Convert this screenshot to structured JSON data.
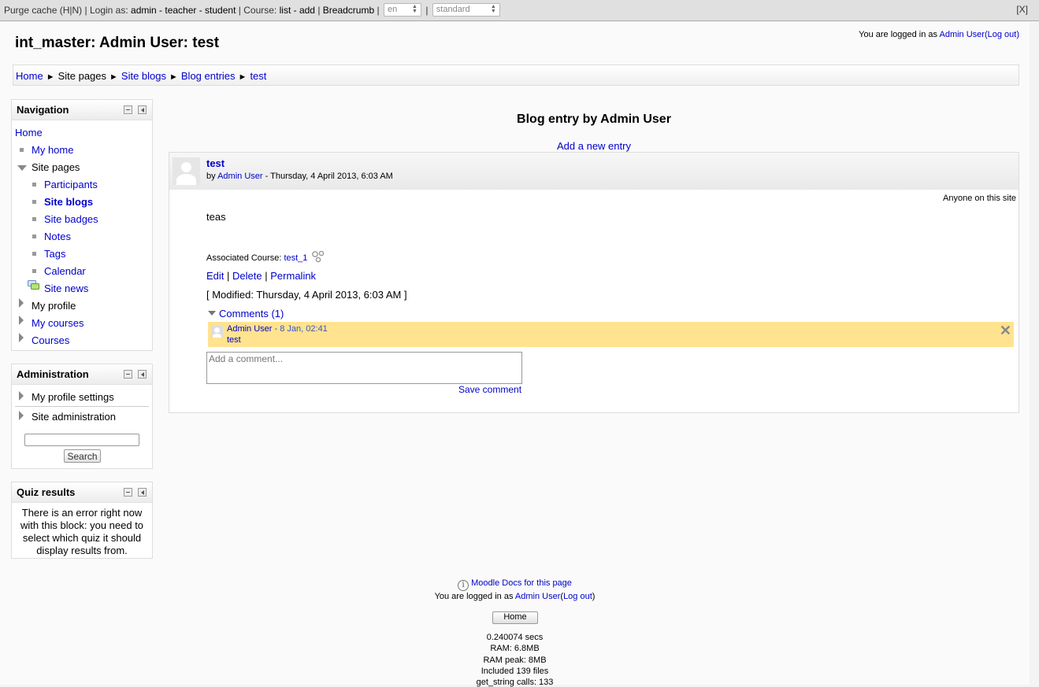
{
  "devbar": {
    "purge": "Purge cache (H|N)",
    "login_as": "Login as:",
    "roles": "admin - teacher - student",
    "course": "Course:",
    "course_links": "list - add",
    "breadcrumb": "Breadcrumb",
    "lang": "en",
    "theme": "standard",
    "close": "[X]",
    "sep": "|"
  },
  "header": {
    "title": "int_master: Admin User: test",
    "logged_in_prefix": "You are logged in as",
    "user": "Admin User",
    "logout": "(Log out)"
  },
  "breadcrumb": {
    "items": [
      "Home",
      "Site pages",
      "Site blogs",
      "Blog entries",
      "test"
    ],
    "sep": "►"
  },
  "navigation": {
    "title": "Navigation",
    "home": "Home",
    "my_home": "My home",
    "site_pages": "Site pages",
    "participants": "Participants",
    "site_blogs": "Site blogs",
    "site_badges": "Site badges",
    "notes": "Notes",
    "tags": "Tags",
    "calendar": "Calendar",
    "site_news": "Site news",
    "my_profile": "My profile",
    "my_courses": "My courses",
    "courses": "Courses"
  },
  "administration": {
    "title": "Administration",
    "my_profile_settings": "My profile settings",
    "site_administration": "Site administration",
    "search_button": "Search"
  },
  "quiz": {
    "title": "Quiz results",
    "message": "There is an error right now with this block: you need to select which quiz it should display results from."
  },
  "blog": {
    "heading": "Blog entry by Admin User",
    "add_entry": "Add a new entry",
    "subject": "test",
    "by": "by",
    "author": "Admin User",
    "date": "- Thursday, 4 April 2013, 6:03 AM",
    "visibility": "Anyone on this site",
    "content": "teas",
    "assoc_label": "Associated Course:",
    "assoc_course": "test_1",
    "edit": "Edit",
    "delete": "Delete",
    "permalink": "Permalink",
    "pipe": "|",
    "modified": "[ Modified: Thursday, 4 April 2013, 6:03 AM ]",
    "comments_toggle": "Comments (1)",
    "comment_author": "Admin User",
    "comment_time": "- 8 Jan, 02:41",
    "comment_text": "test",
    "comment_placeholder": "Add a comment...",
    "save_comment": "Save comment"
  },
  "footer": {
    "docs": "Moodle Docs for this page",
    "logged_in_prefix": "You are logged in as",
    "user": "Admin User",
    "logout": "Log out",
    "home_button": "Home",
    "perf": [
      "0.240074 secs",
      "RAM: 6.8MB",
      "RAM peak: 8MB",
      "Included 139 files",
      "get_string calls: 133"
    ]
  }
}
